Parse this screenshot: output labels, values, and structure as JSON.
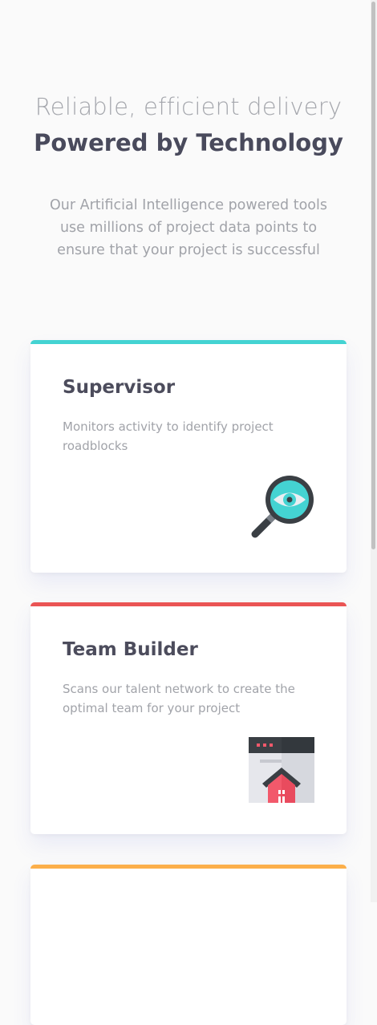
{
  "header": {
    "eyebrow": "Reliable, efficient delivery",
    "title": "Powered by Technology",
    "intro": "Our Artificial Intelligence powered tools use millions of project data points to ensure that your project is successful"
  },
  "cards": [
    {
      "title": "Supervisor",
      "description": "Monitors activity to identify project roadblocks",
      "icon": "magnifier-eye-icon",
      "accent": "#44d3d2"
    },
    {
      "title": "Team Builder",
      "description": "Scans our talent network to create the optimal team for your project",
      "icon": "browser-house-icon",
      "accent": "#ea5454"
    },
    {
      "accent": "#fcaf4a"
    }
  ]
}
